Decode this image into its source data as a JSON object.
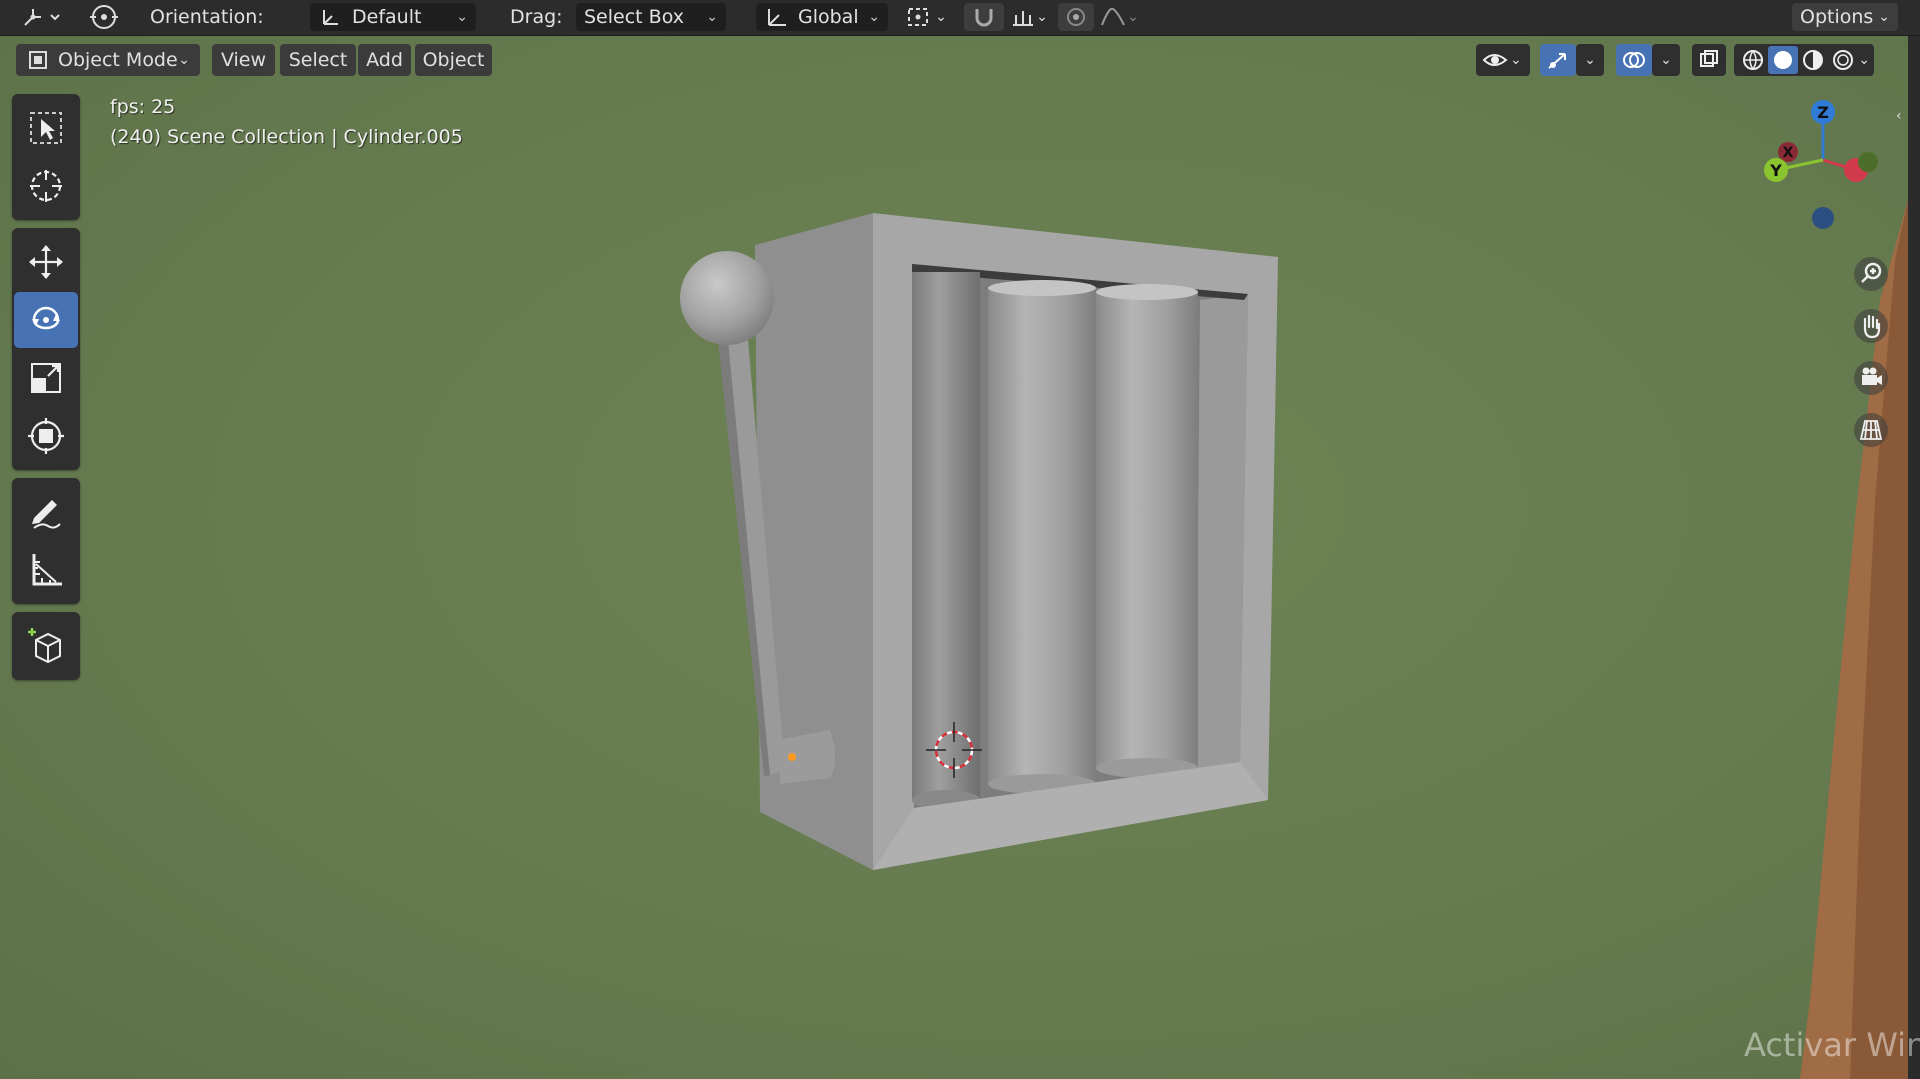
{
  "topbar": {
    "orientation_label": "Orientation:",
    "orientation_value": "Default",
    "drag_label": "Drag:",
    "drag_value": "Select Box",
    "transform_space": "Global",
    "options_label": "Options"
  },
  "header": {
    "mode": "Object Mode",
    "menus": [
      "View",
      "Select",
      "Add",
      "Object"
    ]
  },
  "overlay": {
    "fps": "fps: 25",
    "info": "(240) Scene Collection | Cylinder.005"
  },
  "gizmo": {
    "z": "Z",
    "y": "Y",
    "x": "X"
  },
  "watermark": "Activar Win",
  "colors": {
    "viewport_bg": "#657a4f",
    "active_tool": "#4772b3",
    "axis_x": "#d13a4c",
    "axis_y": "#8ac42f",
    "axis_z": "#2f7bd6",
    "object_gray": "#9a9a9a"
  },
  "tools": {
    "active": "rotate",
    "list": [
      "select-box",
      "cursor",
      "move",
      "rotate",
      "scale",
      "transform",
      "annotate",
      "measure",
      "add-cube"
    ]
  },
  "icons": [
    "select-box-icon",
    "cursor-icon",
    "move-icon",
    "rotate-icon",
    "scale-icon",
    "transform-icon",
    "annotate-icon",
    "measure-icon",
    "add-cube-icon",
    "zoom-icon",
    "hand-icon",
    "camera-icon",
    "grid-icon"
  ]
}
